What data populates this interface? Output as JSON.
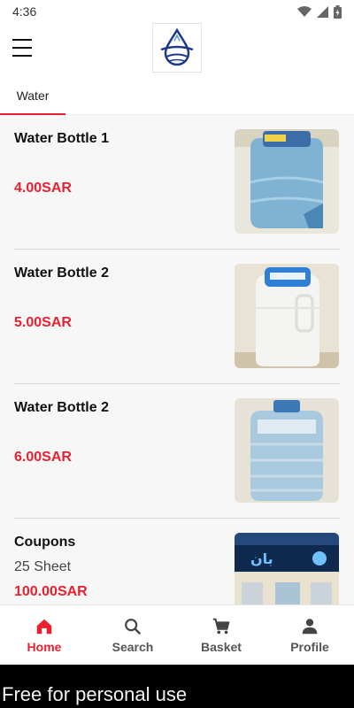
{
  "status_bar": {
    "time": "4:36"
  },
  "tabs": [
    {
      "label": "Water"
    }
  ],
  "products": [
    {
      "name": "Water Bottle 1",
      "price": "4.00SAR"
    },
    {
      "name": "Water Bottle 2",
      "price": "5.00SAR"
    },
    {
      "name": "Water Bottle 2",
      "price": "6.00SAR"
    },
    {
      "name": "Coupons",
      "sub": "25 Sheet",
      "price": "100.00SAR",
      "thumb_text": "بان"
    }
  ],
  "bottom_nav": [
    {
      "label": "Home",
      "icon": "home-icon",
      "active": true
    },
    {
      "label": "Search",
      "icon": "search-icon"
    },
    {
      "label": "Basket",
      "icon": "cart-icon"
    },
    {
      "label": "Profile",
      "icon": "person-icon"
    }
  ],
  "watermark": "Free for personal use",
  "colors": {
    "accent": "#e8202f",
    "water_blue": "#5fa0c8"
  }
}
